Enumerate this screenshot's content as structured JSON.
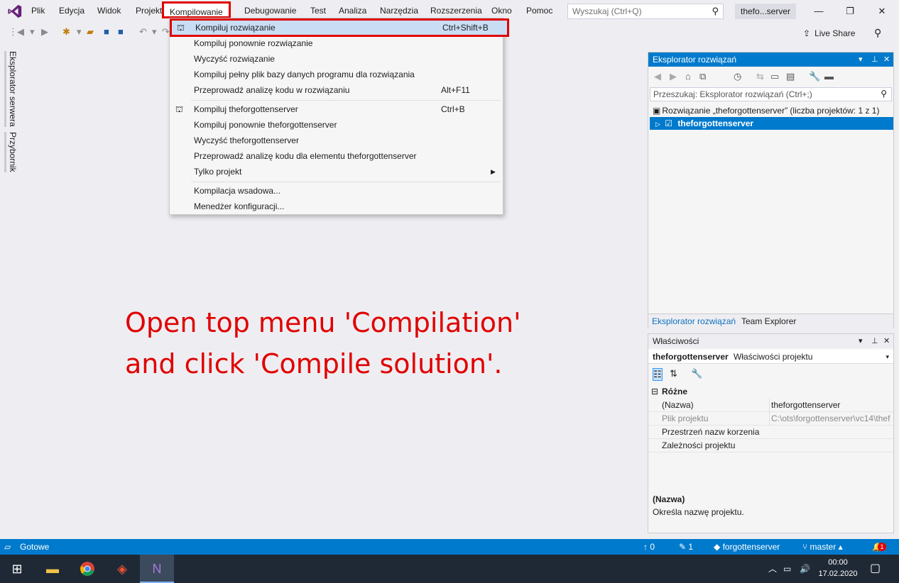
{
  "menubar": {
    "items": [
      "Plik",
      "Edycja",
      "Widok",
      "Projekt",
      "Kompilowanie",
      "Debugowanie",
      "Test",
      "Analiza",
      "Narzędzia",
      "Rozszerzenia",
      "Okno",
      "Pomoc"
    ],
    "search_placeholder": "Wyszukaj (Ctrl+Q)",
    "solution_name": "thefo...server"
  },
  "toolbar": {
    "live_share": "Live Share"
  },
  "left_tabs": [
    "Eksplorator serwera",
    "Przybornik"
  ],
  "dropdown": {
    "items": [
      {
        "label": "Kompiluj rozwiązanie",
        "shortcut": "Ctrl+Shift+B",
        "icon": "build-icon",
        "highlighted": true
      },
      {
        "label": "Kompiluj ponownie rozwiązanie",
        "shortcut": ""
      },
      {
        "label": "Wyczyść rozwiązanie",
        "shortcut": ""
      },
      {
        "label": "Kompiluj pełny plik bazy danych programu dla rozwiązania",
        "shortcut": ""
      },
      {
        "label": "Przeprowadź analizę kodu w rozwiązaniu",
        "shortcut": "Alt+F11"
      },
      {
        "label": "Kompiluj theforgottenserver",
        "shortcut": "Ctrl+B",
        "icon": "build-icon"
      },
      {
        "label": "Kompiluj ponownie theforgottenserver",
        "shortcut": ""
      },
      {
        "label": "Wyczyść theforgottenserver",
        "shortcut": ""
      },
      {
        "label": "Przeprowadź analizę kodu dla elementu theforgottenserver",
        "shortcut": ""
      },
      {
        "label": "Tylko projekt",
        "shortcut": "",
        "submenu": true
      },
      {
        "label": "Kompilacja wsadowa...",
        "shortcut": ""
      },
      {
        "label": "Menedżer konfiguracji...",
        "shortcut": ""
      }
    ]
  },
  "instruction": {
    "line1": "Open top menu 'Compilation'",
    "line2": "and click 'Compile solution'."
  },
  "solution_explorer": {
    "title": "Eksplorator rozwiązań",
    "search_placeholder": "Przeszukaj: Eksplorator rozwiązań (Ctrl+;)",
    "solution_row": "Rozwiązanie „theforgottenserver” (liczba projektów: 1 z 1)",
    "project_row": "theforgottenserver",
    "tabs": [
      "Eksplorator rozwiązań",
      "Team Explorer"
    ]
  },
  "properties": {
    "title": "Właściwości",
    "object_name": "theforgottenserver",
    "object_type": "Właściwości projektu",
    "category": "Różne",
    "rows": [
      {
        "key": "(Nazwa)",
        "value": "theforgottenserver",
        "dim": false
      },
      {
        "key": "Plik projektu",
        "value": "C:\\ots\\forgottenserver\\vc14\\thef",
        "dim": true
      },
      {
        "key": "Przestrzeń nazw korzenia",
        "value": "",
        "dim": false
      },
      {
        "key": "Zależności projektu",
        "value": "",
        "dim": false
      }
    ],
    "desc_title": "(Nazwa)",
    "desc_text": "Określa nazwę projektu."
  },
  "statusbar": {
    "status": "Gotowe",
    "up_count": "0",
    "edit_count": "1",
    "repo": "forgottenserver",
    "branch": "master",
    "notifications": "1"
  },
  "taskbar": {
    "time": "00:00",
    "date": "17.02.2020"
  },
  "colors": {
    "accent": "#007acc",
    "annotation_red": "#e00000",
    "menu_highlight": "#c9def5"
  }
}
